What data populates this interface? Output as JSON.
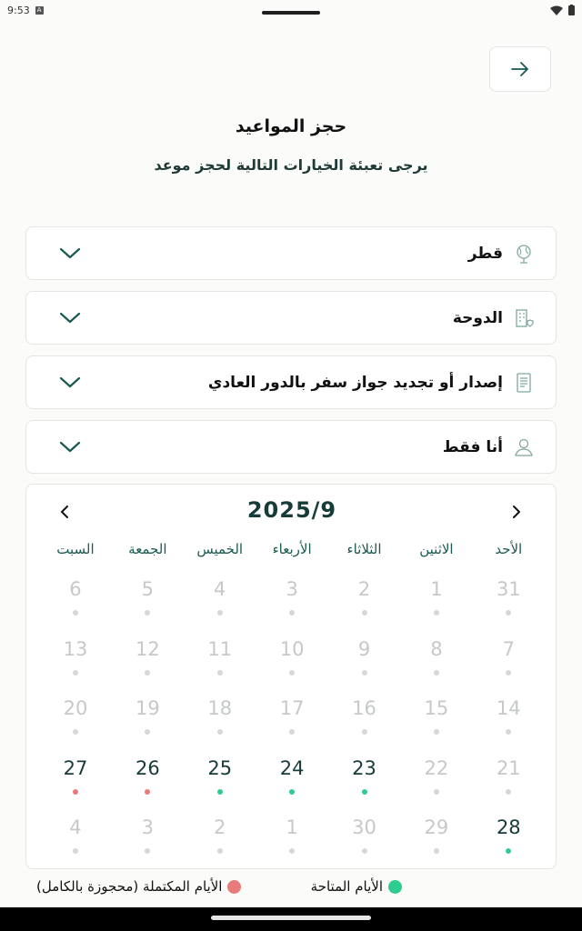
{
  "status_bar": {
    "time": "9:53"
  },
  "header": {
    "title": "حجز المواعيد",
    "subtitle": "يرجى تعبئة الخيارات التالية لحجز موعد"
  },
  "selects": [
    {
      "label": "قطر",
      "icon": "globe-icon"
    },
    {
      "label": "الدوحة",
      "icon": "building-icon"
    },
    {
      "label": "إصدار أو تجديد جواز سفر بالدور العادي",
      "icon": "document-icon"
    },
    {
      "label": "أنا فقط",
      "icon": "user-icon"
    }
  ],
  "calendar": {
    "month_label": "2025/9",
    "weekdays": [
      "الأحد",
      "الاثنين",
      "الثلاثاء",
      "الأربعاء",
      "الخميس",
      "الجمعة",
      "السبت"
    ],
    "weeks": [
      [
        {
          "d": "31",
          "s": "out"
        },
        {
          "d": "1",
          "s": "out"
        },
        {
          "d": "2",
          "s": "out"
        },
        {
          "d": "3",
          "s": "out"
        },
        {
          "d": "4",
          "s": "out"
        },
        {
          "d": "5",
          "s": "out"
        },
        {
          "d": "6",
          "s": "out"
        }
      ],
      [
        {
          "d": "7",
          "s": "out"
        },
        {
          "d": "8",
          "s": "out"
        },
        {
          "d": "9",
          "s": "out"
        },
        {
          "d": "10",
          "s": "out"
        },
        {
          "d": "11",
          "s": "out"
        },
        {
          "d": "12",
          "s": "out"
        },
        {
          "d": "13",
          "s": "out"
        }
      ],
      [
        {
          "d": "14",
          "s": "out"
        },
        {
          "d": "15",
          "s": "out"
        },
        {
          "d": "16",
          "s": "out"
        },
        {
          "d": "17",
          "s": "out"
        },
        {
          "d": "18",
          "s": "out"
        },
        {
          "d": "19",
          "s": "out"
        },
        {
          "d": "20",
          "s": "out"
        }
      ],
      [
        {
          "d": "21",
          "s": "out"
        },
        {
          "d": "22",
          "s": "out"
        },
        {
          "d": "23",
          "s": "available"
        },
        {
          "d": "24",
          "s": "available"
        },
        {
          "d": "25",
          "s": "available"
        },
        {
          "d": "26",
          "s": "full"
        },
        {
          "d": "27",
          "s": "full"
        }
      ],
      [
        {
          "d": "28",
          "s": "available"
        },
        {
          "d": "29",
          "s": "out"
        },
        {
          "d": "30",
          "s": "out"
        },
        {
          "d": "1",
          "s": "out"
        },
        {
          "d": "2",
          "s": "out"
        },
        {
          "d": "3",
          "s": "out"
        },
        {
          "d": "4",
          "s": "out"
        }
      ]
    ]
  },
  "legend": {
    "available_label": "الأيام المتاحة",
    "full_label": "الأيام المكتملة (محجوزة بالكامل)",
    "available_color": "#2ecc8f",
    "full_color": "#e87a7a"
  },
  "colors": {
    "accent": "#1a5a50",
    "title": "#163b39"
  }
}
